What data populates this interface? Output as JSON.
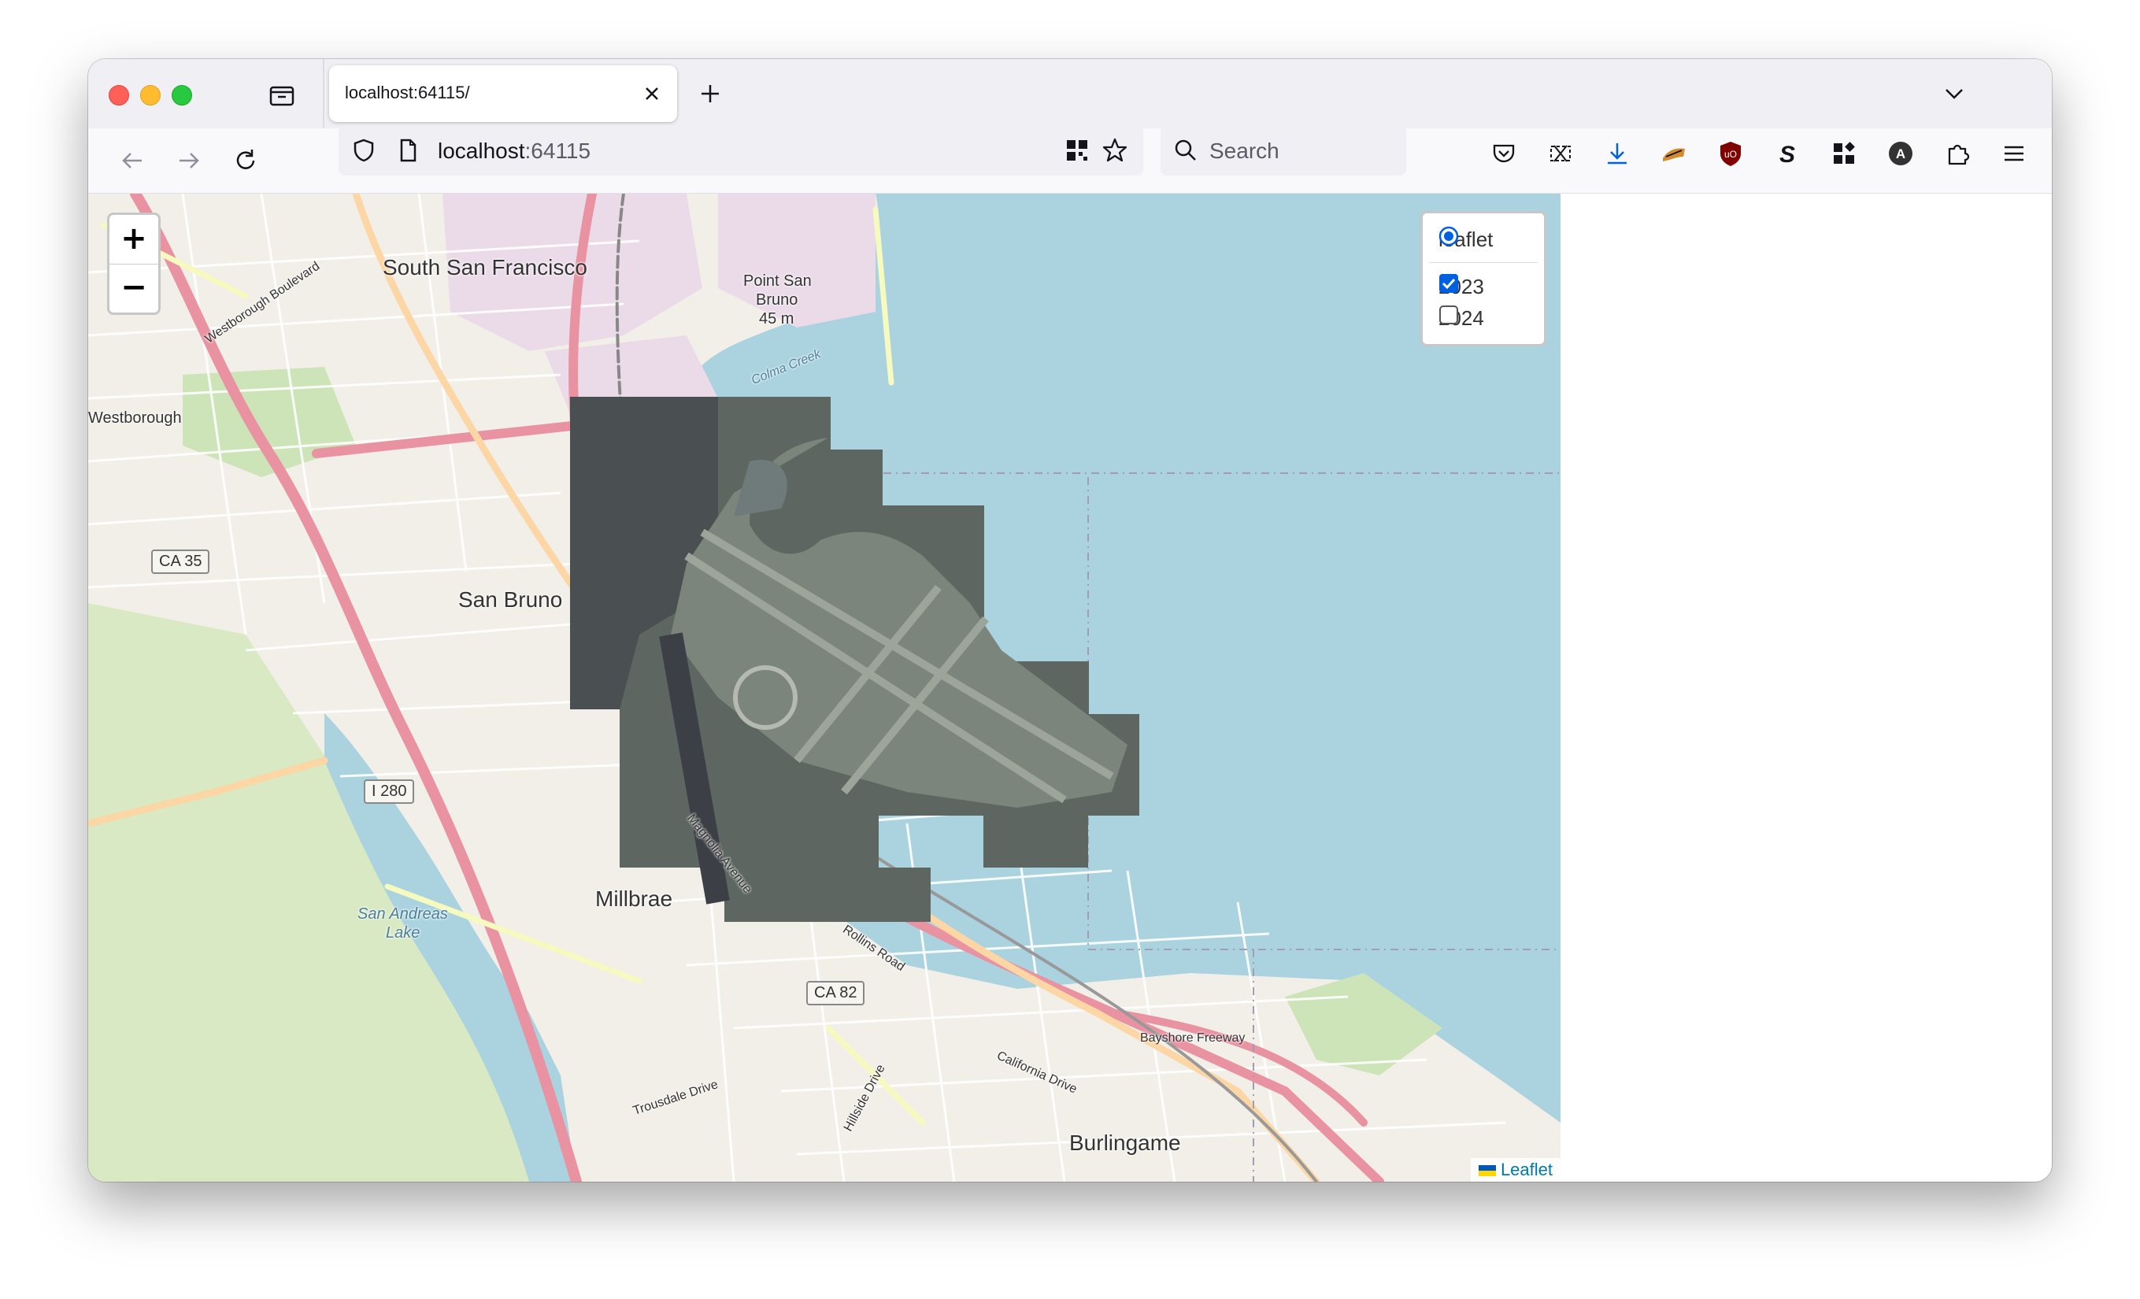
{
  "browser": {
    "tab_title": "localhost:64115/",
    "url_host": "localhost",
    "url_port": ":64115",
    "search_placeholder": "Search"
  },
  "map": {
    "zoom_in_label": "+",
    "zoom_out_label": "−",
    "layer_control": {
      "base_layer": {
        "label": "leaflet",
        "selected": true
      },
      "overlays": [
        {
          "label": "2023",
          "checked": true
        },
        {
          "label": "2024",
          "checked": false
        }
      ]
    },
    "attribution": "Leaflet",
    "labels": {
      "south_sf": "South San Francisco",
      "point_san_bruno": "Point San",
      "point_san_bruno2": "Bruno",
      "point_elev": "45 m",
      "san_bruno": "San Bruno",
      "millbrae": "Millbrae",
      "burlingame": "Burlingame",
      "westborough": "Westborough",
      "san_andreas": "San Andreas",
      "san_andreas2": "Lake",
      "bayshore": "Bayshore Freeway",
      "california_dr": "California Drive",
      "rollins": "Rollins Road",
      "trousdale": "Trousdale Drive",
      "hillside": "Hillside Drive",
      "magnolia": "Magnolia Avenue",
      "westborough_blvd": "Westborough Boulevard",
      "colma_creek": "Colma Creek"
    },
    "shields": {
      "ca35": "CA 35",
      "i280": "I 280",
      "ca82": "CA 82"
    }
  }
}
